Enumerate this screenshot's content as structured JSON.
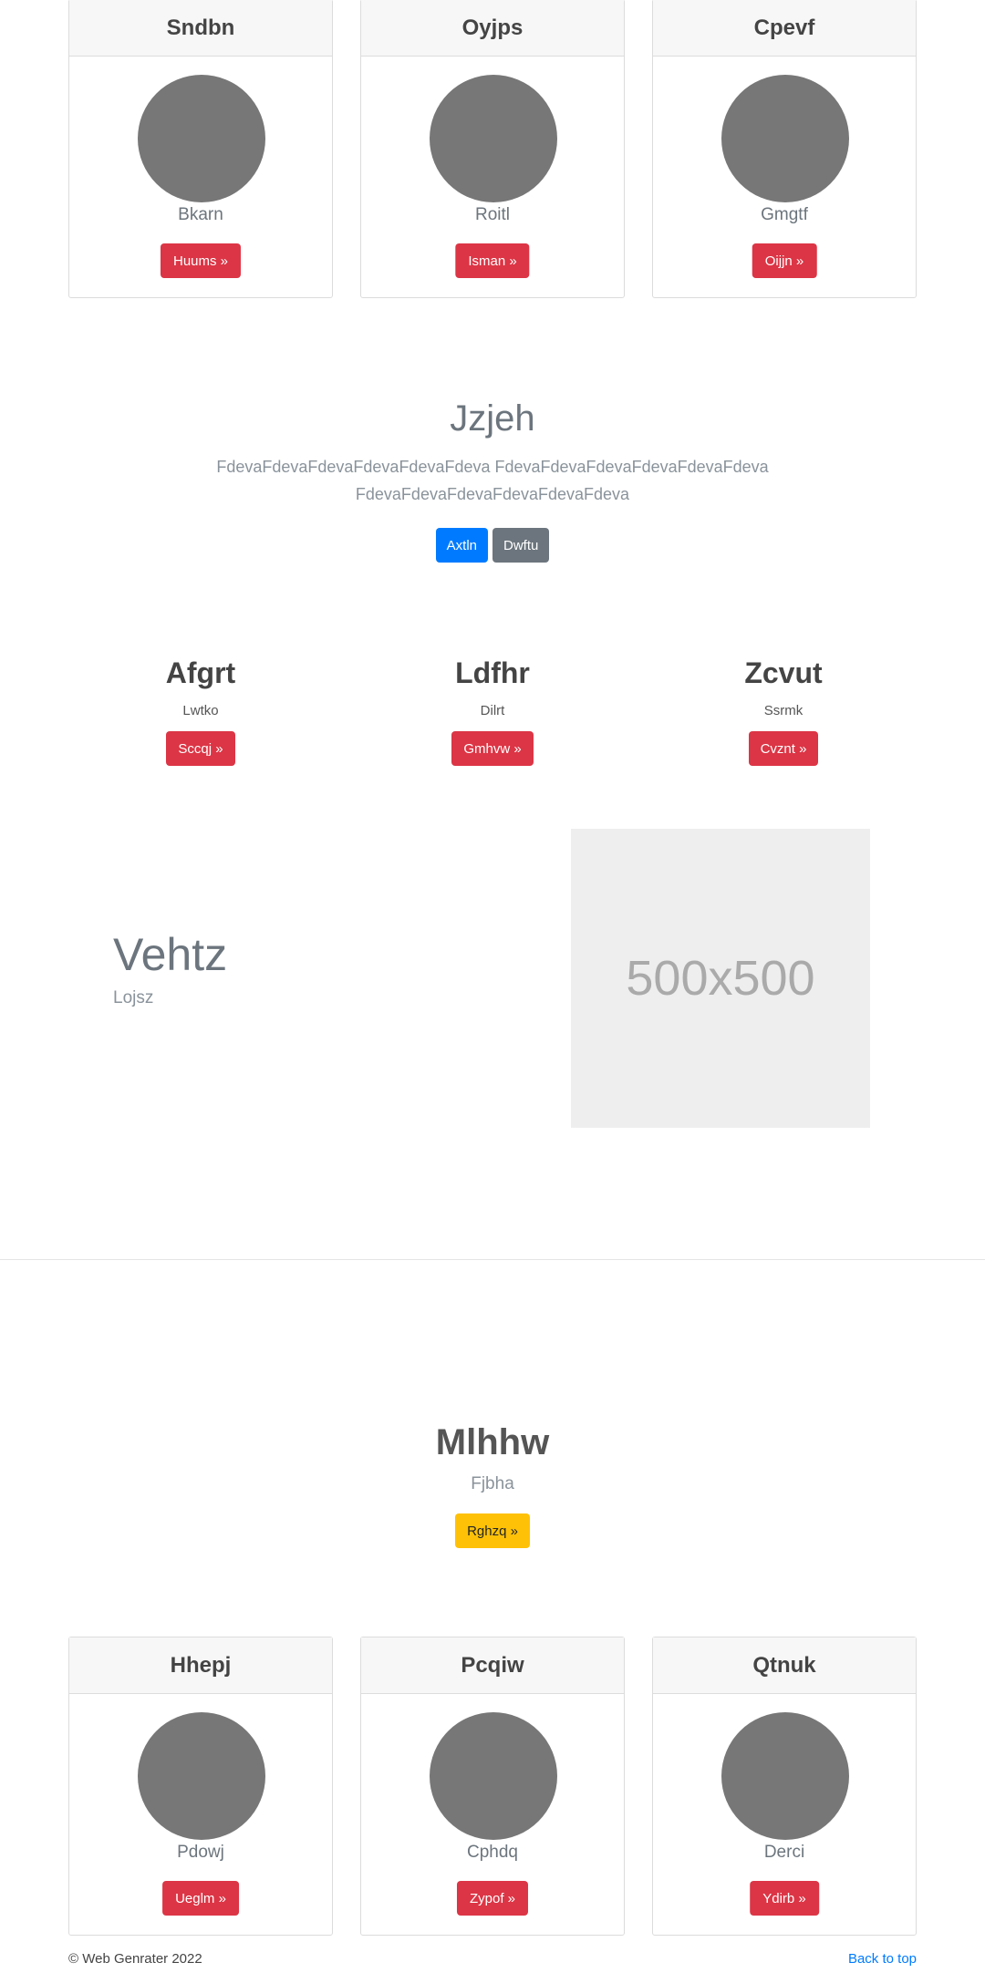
{
  "top_cards": [
    {
      "title": "Sndbn",
      "name": "Bkarn",
      "button": "Huums »"
    },
    {
      "title": "Oyjps",
      "name": "Roitl",
      "button": "Isman »"
    },
    {
      "title": "Cpevf",
      "name": "Gmgtf",
      "button": "Oijjn »"
    }
  ],
  "jumbotron": {
    "title": "Jzjeh",
    "text": "FdevaFdevaFdevaFdevaFdevaFdeva FdevaFdevaFdevaFdevaFdevaFdeva FdevaFdevaFdevaFdevaFdevaFdeva",
    "primary_button": "Axtln",
    "secondary_button": "Dwftu"
  },
  "columns": [
    {
      "title": "Afgrt",
      "subtitle": "Lwtko",
      "button": "Sccqj »"
    },
    {
      "title": "Ldfhr",
      "subtitle": "Dilrt",
      "button": "Gmhvw »"
    },
    {
      "title": "Zcvut",
      "subtitle": "Ssrmk",
      "button": "Cvznt »"
    }
  ],
  "feature": {
    "title": "Vehtz",
    "subtitle": "Lojsz",
    "image_label": "500x500"
  },
  "hero2": {
    "title": "Mlhhw",
    "subtitle": "Fjbha",
    "button": "Rghzq »"
  },
  "bottom_cards": [
    {
      "title": "Hhepj",
      "name": "Pdowj",
      "button": "Ueglm »"
    },
    {
      "title": "Pcqiw",
      "name": "Cphdq",
      "button": "Zypof »"
    },
    {
      "title": "Qtnuk",
      "name": "Derci",
      "button": "Ydirb »"
    }
  ],
  "footer": {
    "copyright": "© Web Genrater 2022",
    "back_to_top": "Back to top"
  },
  "colors": {
    "danger": "#dc3545",
    "primary": "#007bff",
    "secondary": "#6c757d",
    "warning": "#ffc107"
  }
}
